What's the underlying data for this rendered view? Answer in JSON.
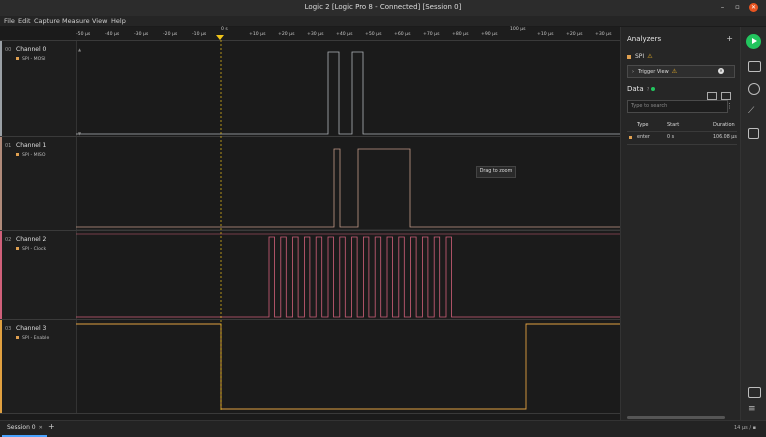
{
  "window": {
    "title": "Logic 2 [Logic Pro 8 - Connected] [Session 0]",
    "controls": [
      "–",
      "▫",
      "✕"
    ]
  },
  "menu": [
    "File",
    "Edit",
    "Capture",
    "Measure",
    "View",
    "Help"
  ],
  "ruler": {
    "ticks": [
      "-50 µs",
      "-40 µs",
      "-30 µs",
      "-20 µs",
      "-10 µs",
      "+10 µs",
      "+20 µs",
      "+30 µs",
      "+40 µs",
      "+50 µs",
      "+60 µs",
      "+70 µs",
      "+80 µs",
      "+90 µs",
      "+10 µs",
      "+20 µs",
      "+30 µs"
    ],
    "zero_label": "0 s",
    "major_label": "100 µs"
  },
  "channels": [
    {
      "num": "00",
      "name": "Channel 0",
      "analyzer": "SPI - MOSI",
      "color": "#9aa0a6"
    },
    {
      "num": "01",
      "name": "Channel 1",
      "analyzer": "SPI - MISO",
      "color": "#b08a7a"
    },
    {
      "num": "02",
      "name": "Channel 2",
      "analyzer": "SPI - Clock",
      "color": "#d0607a"
    },
    {
      "num": "03",
      "name": "Channel 3",
      "analyzer": "SPI - Enable",
      "color": "#e0a040"
    }
  ],
  "tooltip": "Drag to zoom",
  "analyzers": {
    "title": "Analyzers",
    "add": "+",
    "item": "SPI",
    "trigger": "Trigger View"
  },
  "data_panel": {
    "title": "Data",
    "search_placeholder": "Type to search",
    "columns": [
      "Type",
      "Start",
      "Duration"
    ],
    "rows": [
      {
        "type": "enter",
        "start": "0 s",
        "duration": "106.08 µs"
      }
    ]
  },
  "session": {
    "tab": "Session 0",
    "add": "+",
    "zoom": "14 µs / ▪"
  }
}
